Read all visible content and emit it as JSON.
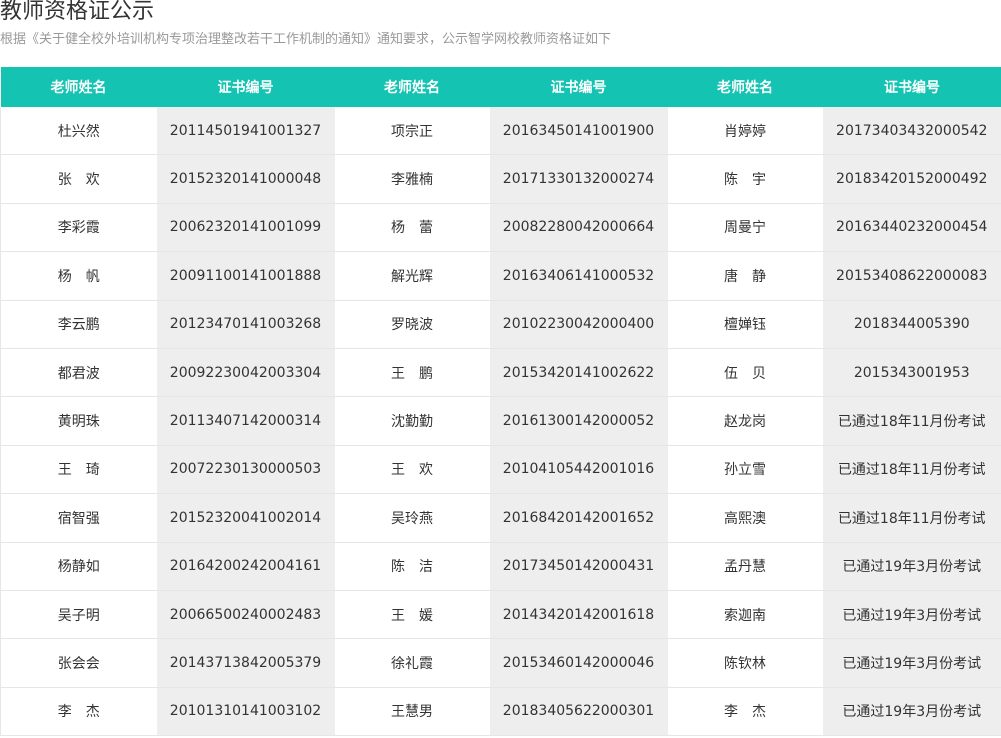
{
  "page": {
    "title": "教师资格证公示",
    "subtitle": "根据《关于健全校外培训机构专项治理整改若干工作机制的通知》通知要求，公示智学网校教师资格证如下"
  },
  "table": {
    "headers": [
      "老师姓名",
      "证书编号",
      "老师姓名",
      "证书编号",
      "老师姓名",
      "证书编号"
    ],
    "rows": [
      [
        "杜兴然",
        "20114501941001327",
        "项宗正",
        "20163450141001900",
        "肖婷婷",
        "20173403432000542"
      ],
      [
        "张　欢",
        "20152320141000048",
        "李雅楠",
        "20171330132000274",
        "陈　宇",
        "20183420152000492"
      ],
      [
        "李彩霞",
        "20062320141001099",
        "杨　蕾",
        "20082280042000664",
        "周曼宁",
        "20163440232000454"
      ],
      [
        "杨　帆",
        "20091100141001888",
        "解光辉",
        "20163406141000532",
        "唐　静",
        "20153408622000083"
      ],
      [
        "李云鹏",
        "20123470141003268",
        "罗晓波",
        "20102230042000400",
        "檀婵钰",
        "2018344005390"
      ],
      [
        "都君波",
        "20092230042003304",
        "王　鹏",
        "20153420141002622",
        "伍　贝",
        "2015343001953"
      ],
      [
        "黄明珠",
        "20113407142000314",
        "沈勤勤",
        "20161300142000052",
        "赵龙岗",
        "已通过18年11月份考试"
      ],
      [
        "王　琦",
        "20072230130000503",
        "王　欢",
        "20104105442001016",
        "孙立雪",
        "已通过18年11月份考试"
      ],
      [
        "宿智强",
        "20152320041002014",
        "吴玲燕",
        "20168420142001652",
        "高熙澳",
        "已通过18年11月份考试"
      ],
      [
        "杨静如",
        "20164200242004161",
        "陈　洁",
        "20173450142000431",
        "孟丹慧",
        "已通过19年3月份考试"
      ],
      [
        "吴子明",
        "20066500240002483",
        "王　媛",
        "20143420142001618",
        "索迦南",
        "已通过19年3月份考试"
      ],
      [
        "张会会",
        "20143713842005379",
        "徐礼霞",
        "20153460142000046",
        "陈钦林",
        "已通过19年3月份考试"
      ],
      [
        "李　杰",
        "20101310141003102",
        "王慧男",
        "20183405622000301",
        "李　杰",
        "已通过19年3月份考试"
      ]
    ]
  },
  "colors": {
    "header_bg": "#14c3b2",
    "header_text": "#ffffff",
    "cert_col_bg": "#eeeeee",
    "name_col_bg": "#ffffff"
  }
}
